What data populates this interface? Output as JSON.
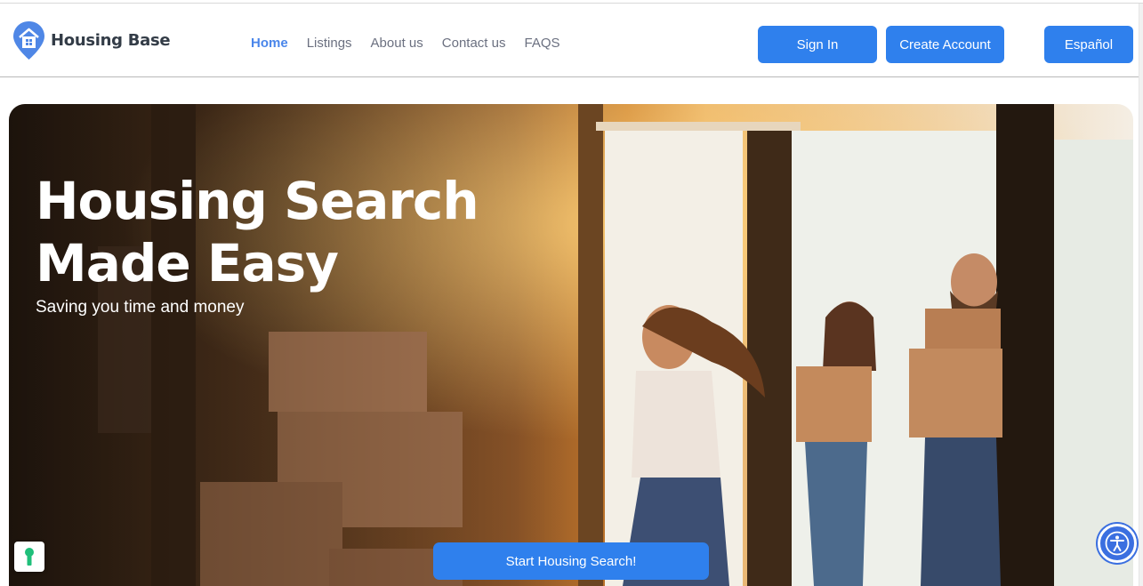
{
  "brand": {
    "name": "Housing Base",
    "accent": "#2f80ed"
  },
  "nav": [
    {
      "label": "Home",
      "active": true
    },
    {
      "label": "Listings",
      "active": false
    },
    {
      "label": "About us",
      "active": false
    },
    {
      "label": "Contact us",
      "active": false
    },
    {
      "label": "FAQS",
      "active": false
    }
  ],
  "auth": {
    "sign_in": "Sign In",
    "create_account": "Create Account"
  },
  "language_button": "Español",
  "hero": {
    "title_line1": "Housing Search",
    "title_line2": "Made Easy",
    "subtitle": "Saving you time and money",
    "cta": "Start Housing Search!"
  },
  "icons": {
    "logo": "house-pin-icon",
    "badge": "keyhole-icon",
    "accessibility": "accessibility-icon"
  }
}
